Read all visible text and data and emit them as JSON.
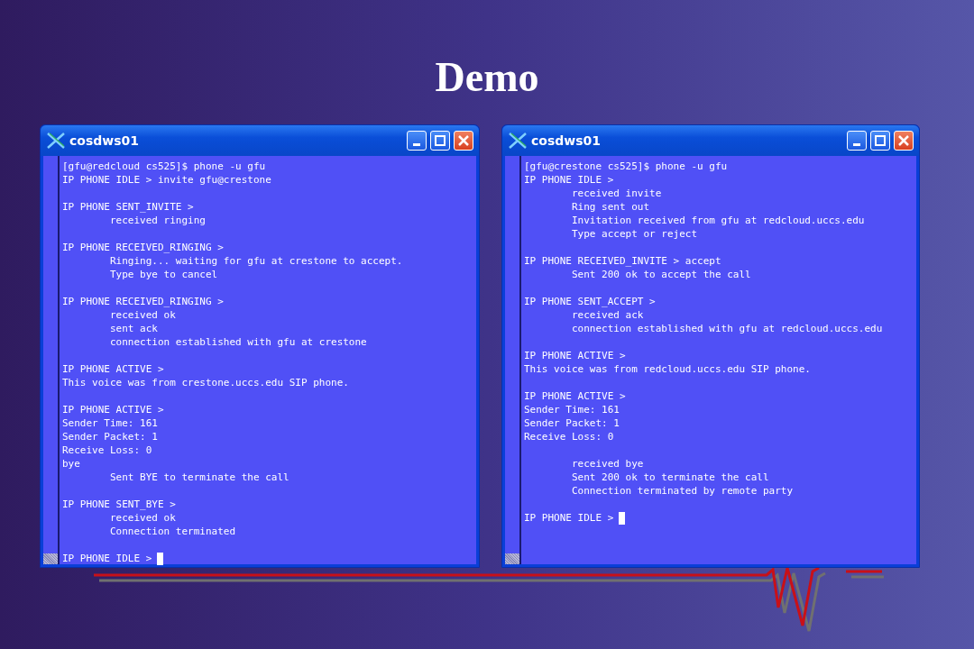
{
  "slide_title": "Demo",
  "windows": [
    {
      "title": "cosdws01",
      "blocks": [
        [
          {
            "text": "[gfu@redcloud cs525]$ phone -u gfu",
            "indented": false
          },
          {
            "text": "IP PHONE IDLE > invite gfu@crestone",
            "indented": false
          }
        ],
        [
          {
            "text": "IP PHONE SENT_INVITE >",
            "indented": false
          },
          {
            "text": "received ringing",
            "indented": true
          }
        ],
        [
          {
            "text": "IP PHONE RECEIVED_RINGING >",
            "indented": false
          },
          {
            "text": "Ringing... waiting for gfu at crestone to accept.",
            "indented": true
          },
          {
            "text": "Type bye to cancel",
            "indented": true
          }
        ],
        [
          {
            "text": "IP PHONE RECEIVED_RINGING >",
            "indented": false
          },
          {
            "text": "received ok",
            "indented": true
          },
          {
            "text": "sent ack",
            "indented": true
          },
          {
            "text": "connection established with gfu at crestone",
            "indented": true
          }
        ],
        [
          {
            "text": "IP PHONE ACTIVE >",
            "indented": false
          },
          {
            "text": "This voice was from crestone.uccs.edu SIP phone.",
            "indented": false
          }
        ],
        [
          {
            "text": "IP PHONE ACTIVE >",
            "indented": false
          },
          {
            "text": "Sender Time: 161",
            "indented": false
          },
          {
            "text": "Sender Packet: 1",
            "indented": false
          },
          {
            "text": "Receive Loss: 0",
            "indented": false
          },
          {
            "text": "bye",
            "indented": false
          },
          {
            "text": "Sent BYE to terminate the call",
            "indented": true
          }
        ],
        [
          {
            "text": "IP PHONE SENT_BYE >",
            "indented": false
          },
          {
            "text": "received ok",
            "indented": true
          },
          {
            "text": "Connection terminated",
            "indented": true
          }
        ]
      ],
      "prompt": "IP PHONE IDLE >"
    },
    {
      "title": "cosdws01",
      "blocks": [
        [
          {
            "text": "[gfu@crestone cs525]$ phone -u gfu",
            "indented": false
          },
          {
            "text": "IP PHONE IDLE >",
            "indented": false
          },
          {
            "text": "received invite",
            "indented": true
          },
          {
            "text": "Ring sent out",
            "indented": true
          },
          {
            "text": "Invitation received from gfu at redcloud.uccs.edu",
            "indented": true
          },
          {
            "text": "Type accept or reject",
            "indented": true
          }
        ],
        [
          {
            "text": "IP PHONE RECEIVED_INVITE > accept",
            "indented": false
          },
          {
            "text": "Sent 200 ok to accept the call",
            "indented": true
          }
        ],
        [
          {
            "text": "IP PHONE SENT_ACCEPT >",
            "indented": false
          },
          {
            "text": "received ack",
            "indented": true
          },
          {
            "text": "connection established with gfu at redcloud.uccs.edu",
            "indented": true
          }
        ],
        [
          {
            "text": "IP PHONE ACTIVE >",
            "indented": false
          },
          {
            "text": "This voice was from redcloud.uccs.edu SIP phone.",
            "indented": false
          }
        ],
        [
          {
            "text": "IP PHONE ACTIVE >",
            "indented": false
          },
          {
            "text": "Sender Time: 161",
            "indented": false
          },
          {
            "text": "Sender Packet: 1",
            "indented": false
          },
          {
            "text": "Receive Loss: 0",
            "indented": false
          }
        ],
        [
          {
            "text": "received bye",
            "indented": true
          },
          {
            "text": "Sent 200 ok to terminate the call",
            "indented": true
          },
          {
            "text": "Connection terminated by remote party",
            "indented": true
          }
        ]
      ],
      "prompt": "IP PHONE IDLE >"
    }
  ]
}
